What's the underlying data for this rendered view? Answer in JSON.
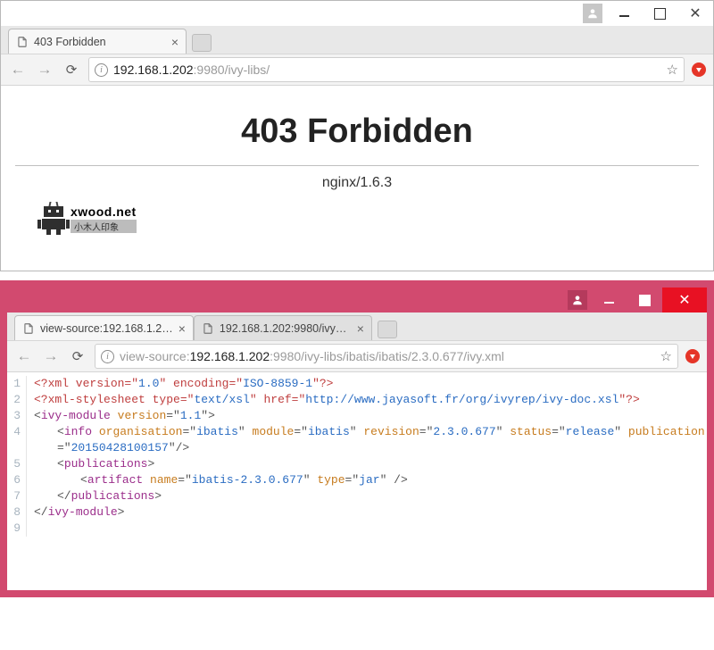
{
  "window1": {
    "title_btns": {
      "user": true
    },
    "tab": {
      "title": "403 Forbidden",
      "favicon": "file-icon"
    },
    "url": {
      "grey_prefix": "",
      "host": "192.168.1.202",
      "grey_suffix": ":9980/ivy-libs/"
    },
    "page": {
      "heading": "403 Forbidden",
      "server": "nginx/1.6.3",
      "watermark_a": "xwood.net",
      "watermark_b": "小木人印象"
    }
  },
  "window2": {
    "tabs": [
      {
        "title": "view-source:192.168.1.2…",
        "active": true,
        "favicon": "file-icon"
      },
      {
        "title": "192.168.1.202:9980/ivy…",
        "active": false,
        "favicon": "file-icon"
      }
    ],
    "url": {
      "grey_prefix": "view-source:",
      "host": "192.168.1.202",
      "grey_suffix": ":9980/ivy-libs/ibatis/ibatis/2.3.0.677/ivy.xml"
    },
    "lines": [
      "1",
      "2",
      "3",
      "4",
      "5",
      "6",
      "7",
      "8",
      "9"
    ],
    "xml": {
      "version": "1.0",
      "encoding": "ISO-8859-1",
      "stylesheet_type": "text/xsl",
      "stylesheet_href": "http://www.jayasoft.fr/org/ivyrep/ivy-doc.xsl",
      "module_version": "1.1",
      "info": {
        "organisation": "ibatis",
        "module": "ibatis",
        "revision": "2.3.0.677",
        "status": "release",
        "publication": "20150428100157"
      },
      "artifact": {
        "name": "ibatis-2.3.0.677",
        "type": "jar"
      }
    }
  }
}
